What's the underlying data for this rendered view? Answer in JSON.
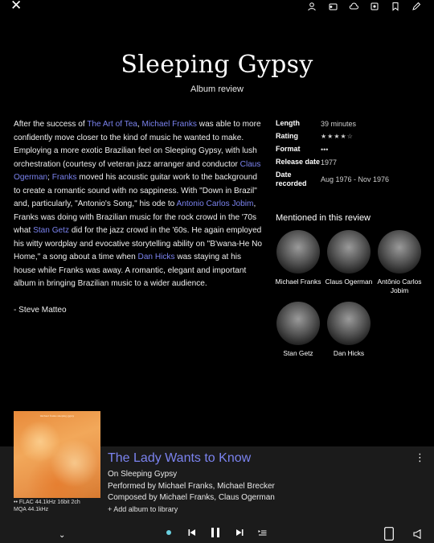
{
  "album": {
    "title": "Sleeping Gypsy",
    "subtitle": "Album review"
  },
  "review": {
    "paragraph_parts": [
      {
        "t": "After the success of "
      },
      {
        "t": "The Art of Tea",
        "link": true
      },
      {
        "t": ", "
      },
      {
        "t": "Michael Franks",
        "link": true
      },
      {
        "t": " was able to more confidently move closer to the kind of music he wanted to make. Employing a more exotic Brazilian feel on Sleeping Gypsy, with lush orchestration (courtesy of veteran jazz arranger and conductor "
      },
      {
        "t": "Claus Ogerman",
        "link": true
      },
      {
        "t": "; "
      },
      {
        "t": "Franks",
        "link": true
      },
      {
        "t": " moved his acoustic guitar work to the background to create a romantic sound with no sappiness. With \"Down in Brazil\" and, particularly, \"Antonio's Song,\" his ode to "
      },
      {
        "t": "Antonio Carlos Jobim",
        "link": true
      },
      {
        "t": ", Franks was doing with Brazilian music for the rock crowd in the '70s what "
      },
      {
        "t": "Stan Getz",
        "link": true
      },
      {
        "t": " did for the jazz crowd in the '60s. He again employed his witty wordplay and evocative storytelling ability on \"B'wana-He No Home,\" a song about a time when "
      },
      {
        "t": "Dan Hicks",
        "link": true
      },
      {
        "t": " was staying at his house while Franks was away. A romantic, elegant and important album in bringing Brazilian music to a wider audience."
      }
    ],
    "author": "- Steve Matteo"
  },
  "meta": [
    {
      "key": "Length",
      "value": "39 minutes"
    },
    {
      "key": "Rating",
      "value": "★★★★☆"
    },
    {
      "key": "Format",
      "value": "•••"
    },
    {
      "key": "Release date",
      "value": "1977"
    },
    {
      "key": "Date recorded",
      "value": "Aug 1976 - Nov 1976"
    }
  ],
  "mentioned": {
    "heading": "Mentioned in this review",
    "people": [
      {
        "name": "Michael Franks"
      },
      {
        "name": "Claus Ogerman"
      },
      {
        "name": "Antônio Carlos Jobim"
      },
      {
        "name": "Stan Getz"
      },
      {
        "name": "Dan Hicks"
      }
    ]
  },
  "player": {
    "track_title": "The Lady Wants to Know",
    "on_album": "On Sleeping Gypsy",
    "performed_by": "Performed by Michael Franks, Michael Brecker",
    "composed_by": "Composed by Michael Franks, Claus Ogerman",
    "add_library": "Add album to library",
    "format_line1": "FLAC 44.1kHz 16bit 2ch",
    "format_line2": "MQA 44.1kHz",
    "cover_text": "michael franks sleeping gypsy"
  },
  "icons": {
    "close": "close-icon",
    "top": [
      "person-icon",
      "cast-icon",
      "cloud-icon",
      "speaker-icon",
      "bookmark-icon",
      "edit-icon"
    ]
  },
  "colors": {
    "link": "#7b83ef",
    "accent_dot": "#6ad0e0"
  }
}
